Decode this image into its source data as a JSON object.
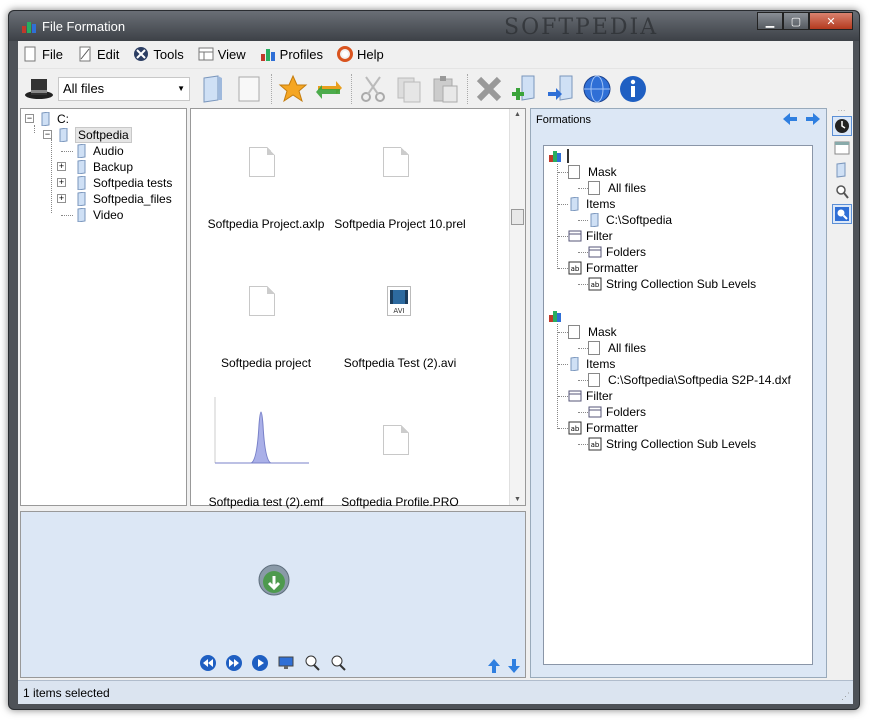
{
  "window": {
    "title": "File Formation",
    "watermark": "SOFTPEDIA"
  },
  "menu": [
    {
      "label": "File",
      "icon": "file-icon"
    },
    {
      "label": "Edit",
      "icon": "edit-icon"
    },
    {
      "label": "Tools",
      "icon": "tools-icon"
    },
    {
      "label": "View",
      "icon": "view-icon"
    },
    {
      "label": "Profiles",
      "icon": "profiles-icon"
    },
    {
      "label": "Help",
      "icon": "help-icon"
    }
  ],
  "toolbar": {
    "filter_value": "All files"
  },
  "folder_tree": {
    "root": "C:",
    "selected": "Softpedia",
    "children": [
      "Audio",
      "Backup",
      "Softpedia tests",
      "Softpedia_files",
      "Video"
    ]
  },
  "files": [
    {
      "name": "Softpedia Project.axlp",
      "kind": "doc"
    },
    {
      "name": "Softpedia Project 10.prel",
      "kind": "doc"
    },
    {
      "name": "Softpedia project",
      "kind": "doc"
    },
    {
      "name": "Softpedia Test (2).avi",
      "kind": "avi"
    },
    {
      "name": "Softpedia test (2).emf",
      "kind": "chart"
    },
    {
      "name": "Softpedia Profile.PRO",
      "kind": "doc"
    }
  ],
  "formations": {
    "title": "Formations",
    "groups": [
      {
        "mask_label": "Mask",
        "mask_value": "All files",
        "items_label": "Items",
        "items_value": "C:\\Softpedia",
        "filter_label": "Filter",
        "filter_value": "Folders",
        "formatter_label": "Formatter",
        "formatter_value": "String Collection Sub Levels"
      },
      {
        "mask_label": "Mask",
        "mask_value": "All files",
        "items_label": "Items",
        "items_value": "C:\\Softpedia\\Softpedia S2P-14.dxf",
        "filter_label": "Filter",
        "filter_value": "Folders",
        "formatter_label": "Formatter",
        "formatter_value": "String Collection Sub Levels"
      }
    ]
  },
  "status": {
    "text": "1 items selected"
  }
}
